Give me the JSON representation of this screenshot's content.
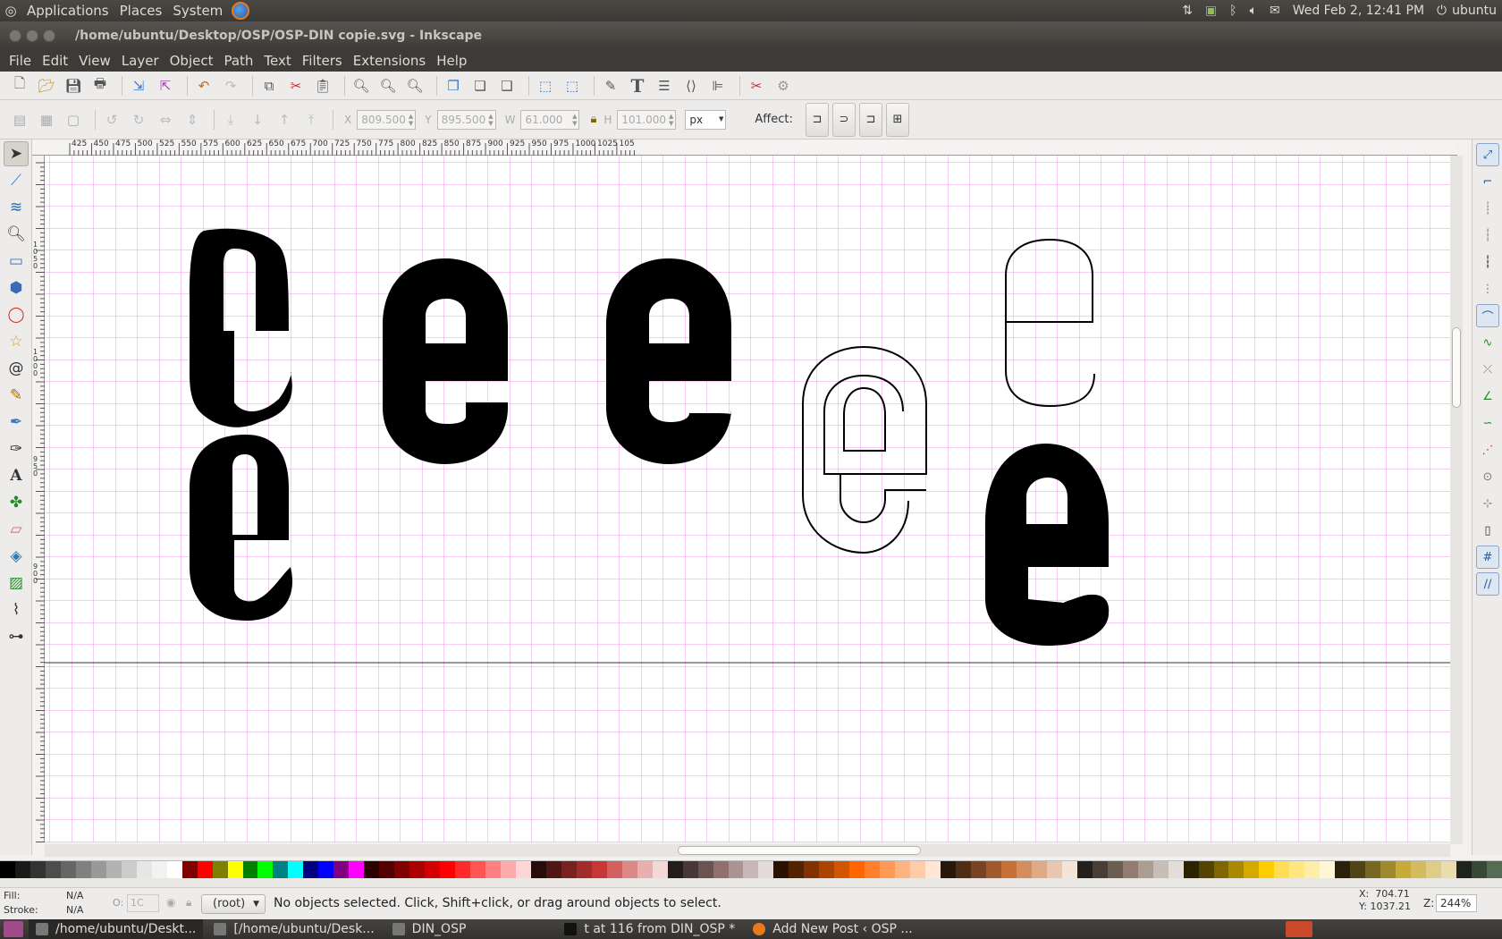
{
  "topbar": {
    "menus": [
      "Applications",
      "Places",
      "System"
    ],
    "datetime": "Wed Feb  2, 12:41 PM",
    "user": "ubuntu"
  },
  "window": {
    "title": "/home/ubuntu/Desktop/OSP/OSP-DIN copie.svg - Inkscape"
  },
  "menubar": [
    "File",
    "Edit",
    "View",
    "Layer",
    "Object",
    "Path",
    "Text",
    "Filters",
    "Extensions",
    "Help"
  ],
  "controls": {
    "x_label": "X",
    "x_value": "809.500",
    "y_label": "Y",
    "y_value": "895.500",
    "w_label": "W",
    "w_value": "61.000",
    "h_label": "H",
    "h_value": "101.000",
    "unit": "px",
    "affect_label": "Affect:"
  },
  "ruler": {
    "h_labels": [
      "425",
      "450",
      "475",
      "500",
      "525",
      "550",
      "575",
      "600",
      "625",
      "650",
      "675",
      "700",
      "725",
      "750",
      "775",
      "800",
      "825",
      "850",
      "875",
      "900",
      "925",
      "950",
      "975",
      "1000",
      "1025",
      "105"
    ],
    "v_labels": [
      "1050",
      "1000",
      "950",
      "900"
    ]
  },
  "status": {
    "fill_label": "Fill:",
    "fill_value": "N/A",
    "stroke_label": "Stroke:",
    "stroke_value": "N/A",
    "opacity_label": "O:",
    "opacity_value": "1C",
    "layer": "(root)",
    "message": "No objects selected. Click, Shift+click, or drag around objects to select.",
    "cursor_x": "X:  704.71",
    "cursor_y": "Y: 1037.21",
    "zoom_label": "Z:",
    "zoom_value": "244%"
  },
  "taskbar": [
    {
      "label": "/home/ubuntu/Deskt..."
    },
    {
      "label": "[/home/ubuntu/Desk..."
    },
    {
      "label": "DIN_OSP"
    },
    {
      "label": "t at 116 from DIN_OSP *"
    },
    {
      "label": "Add New Post ‹ OSP ..."
    }
  ],
  "palette_colors": [
    "#000000",
    "#1a1a1a",
    "#333333",
    "#4d4d4d",
    "#666666",
    "#808080",
    "#999999",
    "#b3b3b3",
    "#cccccc",
    "#e6e6e6",
    "#f2f2f2",
    "#ffffff",
    "#800000",
    "#ff0000",
    "#808000",
    "#ffff00",
    "#008000",
    "#00ff00",
    "#008080",
    "#00ffff",
    "#000080",
    "#0000ff",
    "#800080",
    "#ff00ff",
    "#2b0000",
    "#550000",
    "#800000",
    "#aa0000",
    "#d40000",
    "#ff0000",
    "#ff2a2a",
    "#ff5555",
    "#ff8080",
    "#ffaaaa",
    "#ffd5d5",
    "#280b0b",
    "#501616",
    "#782121",
    "#a02c2c",
    "#c83737",
    "#d35f5f",
    "#de8787",
    "#e9afaf",
    "#f4d7d7",
    "#241c1c",
    "#483737",
    "#6c5353",
    "#916f6f",
    "#ac9393",
    "#c8b7b7",
    "#e3dbdb",
    "#2b1100",
    "#552200",
    "#803300",
    "#aa4400",
    "#d45500",
    "#ff6600",
    "#ff7f2a",
    "#ff9955",
    "#ffb380",
    "#ffccaa",
    "#ffe6d5",
    "#28170b",
    "#502d16",
    "#784421",
    "#a05a2c",
    "#c87137",
    "#d38d5f",
    "#deaa87",
    "#e9c6af",
    "#f4e3d7",
    "#241f1c",
    "#483e37",
    "#6c5d53",
    "#917c6f",
    "#ac9d93",
    "#c8beb7",
    "#e3dedb",
    "#2b2200",
    "#554400",
    "#806600",
    "#aa8800",
    "#d4aa00",
    "#ffcc00",
    "#ffdd55",
    "#ffe680",
    "#ffeeaa",
    "#fff6d5",
    "#28220b",
    "#504416",
    "#786721",
    "#a0892c",
    "#c8ab37",
    "#d3bc5f",
    "#decd87",
    "#e9ddaf",
    "#1c241c",
    "#374837",
    "#536c53"
  ]
}
